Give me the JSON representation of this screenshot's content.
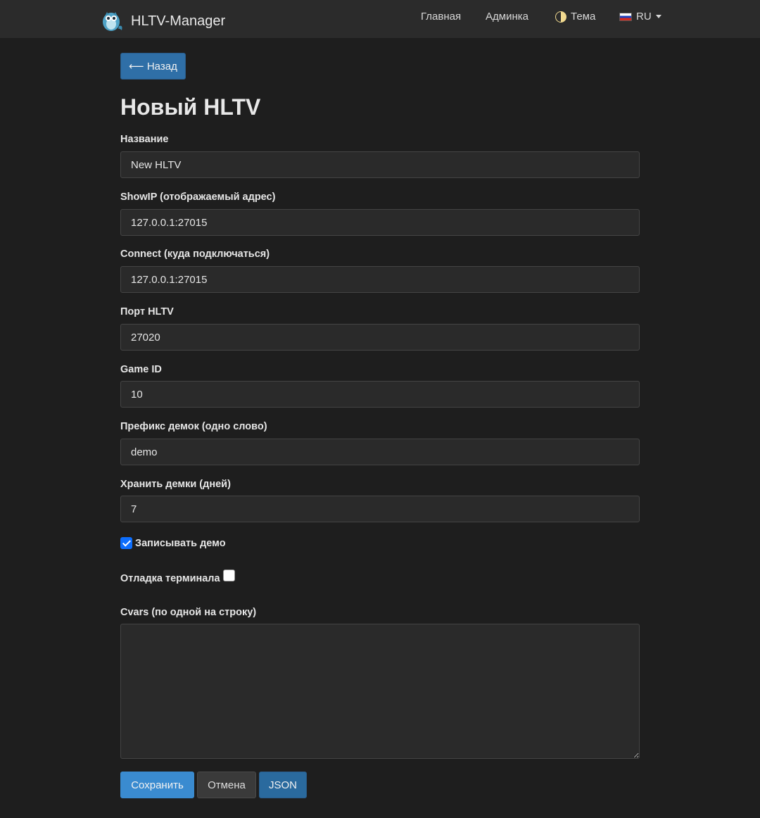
{
  "navbar": {
    "brand": "HLTV-Manager",
    "links": {
      "home": "Главная",
      "admin": "Админка",
      "theme": "Тема",
      "language": "RU"
    }
  },
  "page": {
    "back_label": "⟵ Назад",
    "title": "Новый HLTV"
  },
  "form": {
    "name": {
      "label": "Название",
      "value": "New HLTV"
    },
    "show_ip": {
      "label": "ShowIP (отображаемый адрес)",
      "value": "127.0.0.1:27015"
    },
    "connect": {
      "label": "Connect (куда подключаться)",
      "value": "127.0.0.1:27015"
    },
    "port": {
      "label": "Порт HLTV",
      "value": "27020"
    },
    "game_id": {
      "label": "Game ID",
      "value": "10"
    },
    "demo_prefix": {
      "label": "Префикс демок (одно слово)",
      "value": "demo"
    },
    "keep_days": {
      "label": "Хранить демки (дней)",
      "value": "7"
    },
    "record_demo": {
      "label": "Записывать демо",
      "checked": true
    },
    "terminal_debug": {
      "label": "Отладка терминала",
      "checked": false
    },
    "cvars": {
      "label": "Cvars (по одной на строку)",
      "value": ""
    }
  },
  "actions": {
    "save": "Сохранить",
    "cancel": "Отмена",
    "json": "JSON"
  },
  "colors": {
    "background": "#1e1e1e",
    "navbar": "#2b2b2b",
    "primary": "#3a8bd0",
    "checkbox_checked": "#0d6efd"
  }
}
